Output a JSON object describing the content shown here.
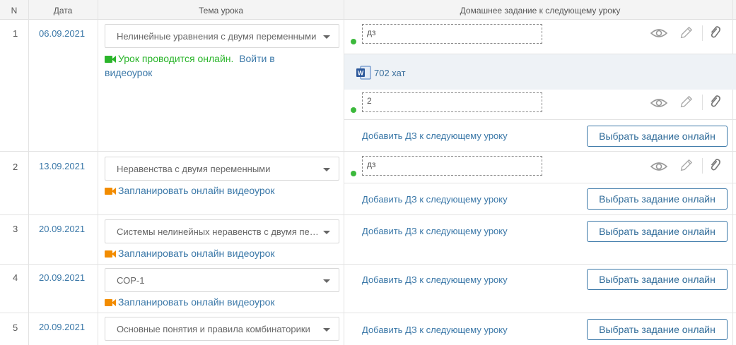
{
  "header": {
    "num": "N",
    "date": "Дата",
    "topic": "Тема урока",
    "homework": "Домашнее задание к следующему уроку"
  },
  "rows": [
    {
      "num": "1",
      "date": "06.09.2021",
      "topic": "Нелинейные уравнения с двумя переменными",
      "video_status": "Урок проводится онлайн.",
      "video_link": "Войти в видеоурок",
      "homework": [
        {
          "value": "дз",
          "attachment": "702 хат"
        },
        {
          "value": "2"
        }
      ],
      "add_hw": "Добавить ДЗ к следующему уроку",
      "pick_online": "Выбрать задание онлайн"
    },
    {
      "num": "2",
      "date": "13.09.2021",
      "topic": "Неравенства с двумя переменными",
      "video_link": "Запланировать онлайн видеоурок",
      "homework": [
        {
          "value": "дз"
        }
      ],
      "add_hw": "Добавить ДЗ к следующему уроку",
      "pick_online": "Выбрать задание онлайн"
    },
    {
      "num": "3",
      "date": "20.09.2021",
      "topic": "Системы нелинейных неравенств с двумя переменными",
      "video_link": "Запланировать онлайн видеоурок",
      "add_hw": "Добавить ДЗ к следующему уроку",
      "pick_online": "Выбрать задание онлайн"
    },
    {
      "num": "4",
      "date": "20.09.2021",
      "topic": "СОР-1",
      "video_link": "Запланировать онлайн видеоурок",
      "add_hw": "Добавить ДЗ к следующему уроку",
      "pick_online": "Выбрать задание онлайн"
    },
    {
      "num": "5",
      "date": "20.09.2021",
      "topic": "Основные понятия и правила комбинаторики",
      "add_hw": "Добавить ДЗ к следующему уроку",
      "pick_online": "Выбрать задание онлайн"
    }
  ],
  "icons": {
    "view": "eye-icon",
    "edit": "pencil-icon",
    "attach": "paperclip-icon",
    "file": "word-doc-icon",
    "video": "video-camera-icon"
  },
  "colors": {
    "link": "#3b78a8",
    "online_green": "#2bb52b",
    "planned_orange": "#f28c00",
    "status_dot": "#3cb93c"
  }
}
